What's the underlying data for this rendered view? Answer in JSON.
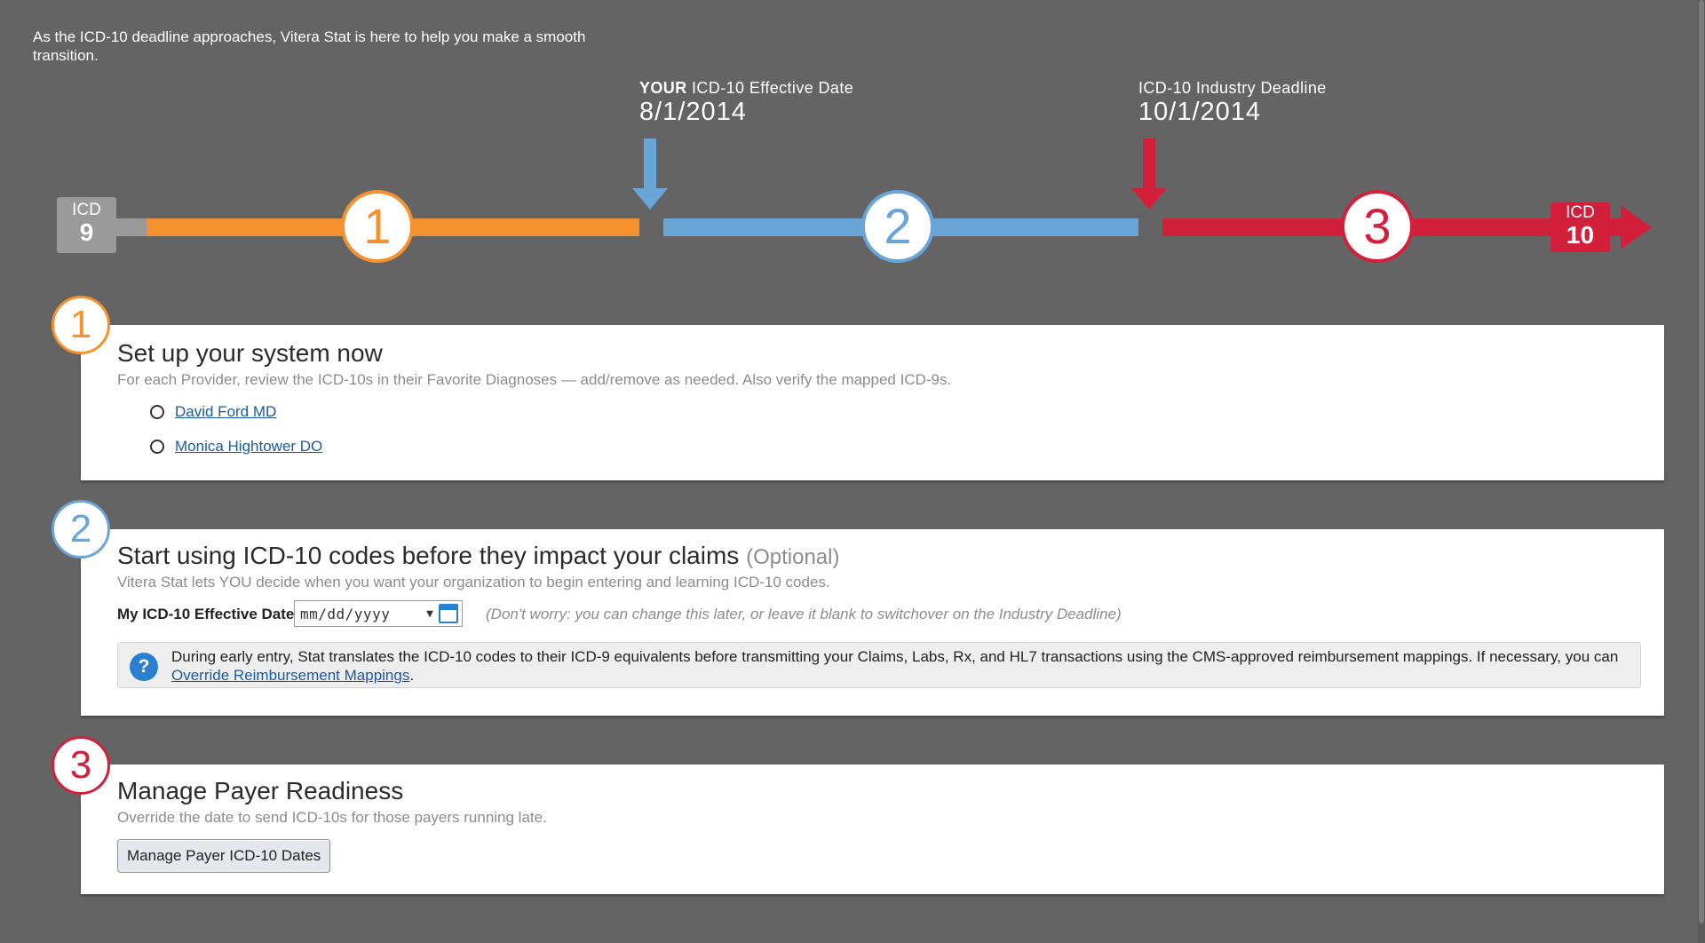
{
  "intro": "As the ICD-10 deadline approaches, Vitera Stat is here to help you make a smooth transition.",
  "timeline": {
    "start_badge": {
      "prefix": "ICD",
      "number": "9"
    },
    "end_badge": {
      "prefix": "ICD",
      "number": "10"
    },
    "effective": {
      "label_strong": "YOUR",
      "label_rest": "ICD-10 Effective Date",
      "date": "8/1/2014"
    },
    "deadline": {
      "label": "ICD-10 Industry Deadline",
      "date": "10/1/2014"
    },
    "steps": [
      "1",
      "2",
      "3"
    ]
  },
  "colors": {
    "phase1": "#f5922f",
    "phase2": "#6aa5d8",
    "phase3": "#d3203a",
    "badge_gray": "#9a9a9a",
    "background": "#646464"
  },
  "sections": {
    "s1": {
      "number": "1",
      "title": "Set up your system now",
      "subtitle": "For each Provider, review the ICD-10s in their Favorite Diagnoses — add/remove as needed. Also verify the mapped ICD-9s.",
      "providers": [
        "David Ford MD",
        "Monica Hightower DO"
      ]
    },
    "s2": {
      "number": "2",
      "title": "Start using ICD-10 codes before they impact your claims",
      "optional": "(Optional)",
      "subtitle": "Vitera Stat lets YOU decide when you want your organization to begin entering and learning ICD-10 codes.",
      "date_label": "My ICD-10 Effective Date",
      "date_placeholder": "mm/dd/yyyy",
      "hint": "(Don't worry: you can change this later, or leave it blank to switchover on the Industry Deadline)",
      "info_icon": "?",
      "info_text": "During early entry, Stat translates the ICD-10 codes to their ICD-9 equivalents before transmitting your Claims, Labs, Rx, and HL7 transactions using the CMS-approved reimbursement mappings. If necessary, you can",
      "info_link": "Override Reimbursement Mappings",
      "info_end": "."
    },
    "s3": {
      "number": "3",
      "title": "Manage Payer Readiness",
      "subtitle": "Override the date to send ICD-10s for those payers running late.",
      "button": "Manage Payer ICD-10 Dates"
    }
  }
}
